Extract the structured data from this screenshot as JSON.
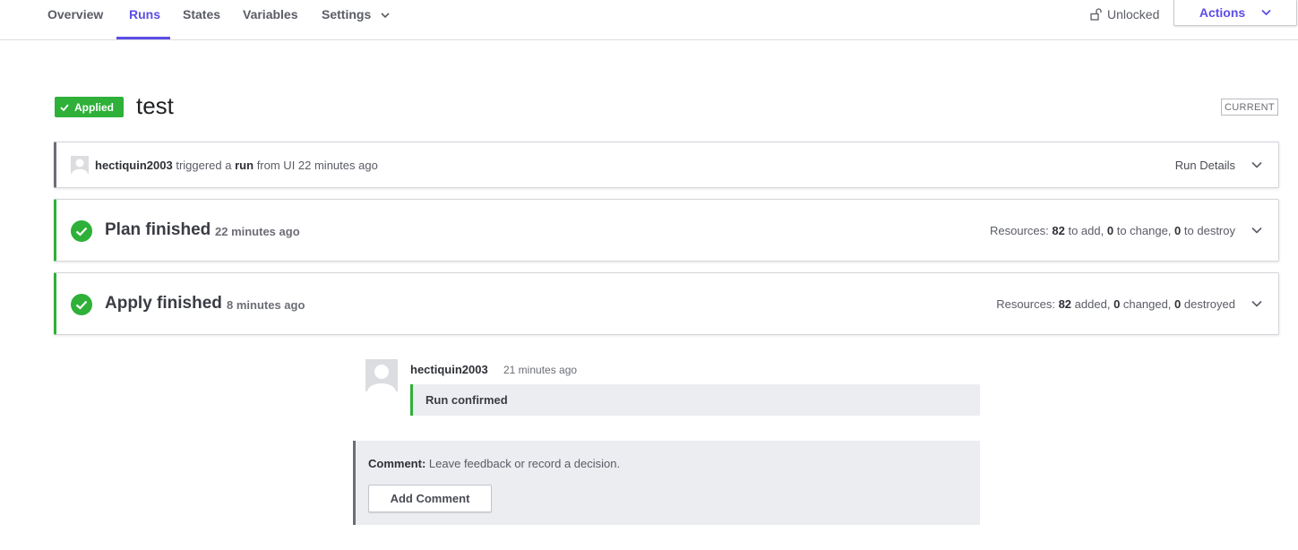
{
  "nav": {
    "tabs": [
      {
        "label": "Overview"
      },
      {
        "label": "Runs"
      },
      {
        "label": "States"
      },
      {
        "label": "Variables"
      },
      {
        "label": "Settings"
      }
    ],
    "active_tab": "Runs",
    "lock_label": "Unlocked",
    "actions_label": "Actions"
  },
  "run": {
    "status": "Applied",
    "title": "test",
    "current_label": "CURRENT"
  },
  "trigger": {
    "user": "hectiquin2003",
    "text1": "triggered a",
    "run_word": "run",
    "text2": "from UI 22 minutes ago",
    "details_label": "Run Details"
  },
  "plan": {
    "title": "Plan finished",
    "time": "22 minutes ago",
    "resources_label": "Resources:",
    "add": "82",
    "add_text": "to add,",
    "change": "0",
    "change_text": "to change,",
    "destroy": "0",
    "destroy_text": "to destroy"
  },
  "apply": {
    "title": "Apply finished",
    "time": "8 minutes ago",
    "resources_label": "Resources:",
    "added": "82",
    "added_text": "added,",
    "changed": "0",
    "changed_text": "changed,",
    "destroyed": "0",
    "destroyed_text": "destroyed"
  },
  "feed": {
    "user": "hectiquin2003",
    "time": "21 minutes ago",
    "message": "Run confirmed"
  },
  "comment": {
    "label": "Comment:",
    "prompt": "Leave feedback or record a decision.",
    "button": "Add Comment"
  },
  "colors": {
    "accent": "#5c4ee5",
    "success": "#2eb039",
    "neutral_border": "#6c6e76"
  }
}
